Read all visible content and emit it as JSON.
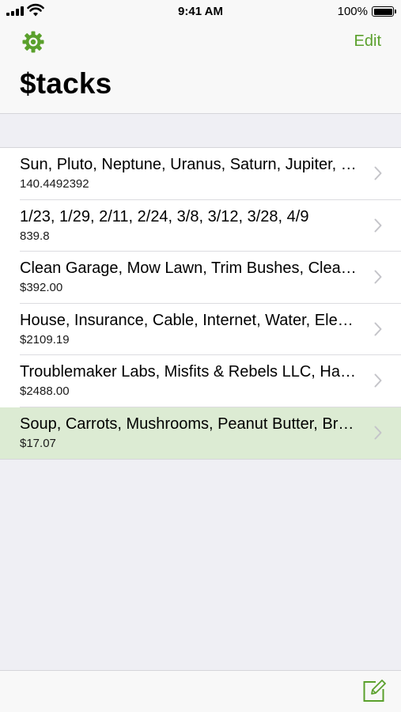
{
  "status_bar": {
    "time": "9:41 AM",
    "battery": "100%"
  },
  "nav": {
    "edit_label": "Edit",
    "title": "$tacks",
    "settings_icon": "gear-icon"
  },
  "stacks": [
    {
      "title": "Sun, Pluto, Neptune, Uranus, Saturn, Jupiter, Mars, Earth, Venus, Mercury",
      "subtitle": "140.4492392",
      "selected": false
    },
    {
      "title": "1/23, 1/29, 2/11, 2/24, 3/8, 3/12, 3/28, 4/9",
      "subtitle": "839.8",
      "selected": false
    },
    {
      "title": "Clean Garage, Mow Lawn, Trim Bushes, Clean Gutters",
      "subtitle": "$392.00",
      "selected": false
    },
    {
      "title": "House, Insurance, Cable, Internet, Water, Electricity",
      "subtitle": "$2109.19",
      "selected": false
    },
    {
      "title": "Troublemaker Labs, Misfits & Rebels LLC, Hackers Inc",
      "subtitle": "$2488.00",
      "selected": false
    },
    {
      "title": "Soup, Carrots, Mushrooms, Peanut Butter, Bread",
      "subtitle": "$17.07",
      "selected": true
    }
  ],
  "toolbar": {
    "compose_icon": "compose-icon"
  },
  "colors": {
    "accent": "#5aa02c",
    "selected_row": "#dcebd3",
    "background": "#efeff4"
  }
}
